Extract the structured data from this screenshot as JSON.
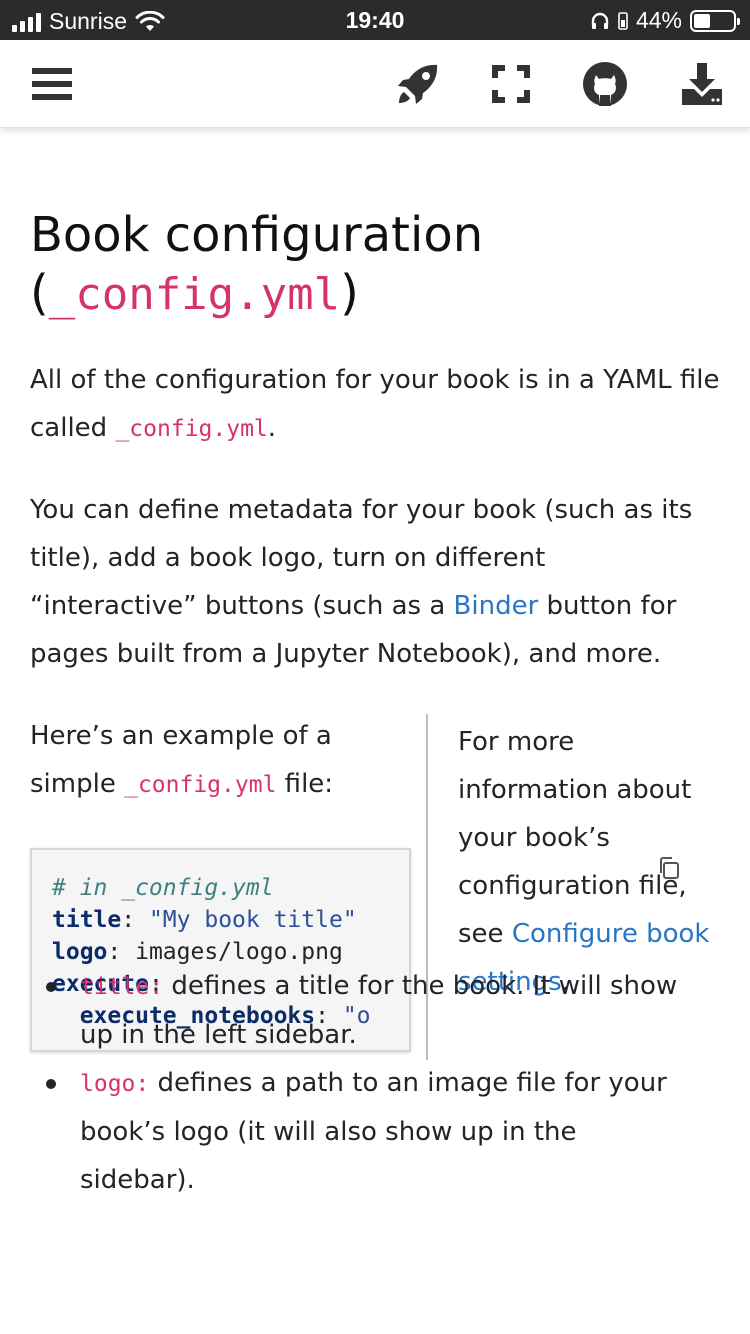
{
  "status_bar": {
    "carrier": "Sunrise",
    "time": "19:40",
    "battery": "44%",
    "battery_level": 0.44
  },
  "toolbar": {
    "icons": [
      "menu-icon",
      "rocket-icon",
      "fullscreen-icon",
      "github-icon",
      "download-icon"
    ]
  },
  "page": {
    "title": "Book configuration (",
    "title_code": "_config.yml",
    "title_end": ")",
    "intro": {
      "text": "All of the configuration for your book is in a YAML file called ",
      "code": "_config.yml",
      "end": "."
    },
    "para2": {
      "before": "You can define metadata for your book (such as its title), add a book logo, turn on different “interactive” buttons (such as a ",
      "link": "Binder",
      "after": " button for pages built from a Jupyter Notebook), and more."
    },
    "example": {
      "before": "Here’s an example of a simple ",
      "code": "_config.yml",
      "after": " file:"
    },
    "code_block": {
      "line1_comment": "# in _config.yml",
      "line2_key": "title",
      "line2_value": "\"My book title\"",
      "line3_key": "logo",
      "line3_value": "images/logo.png",
      "line4_key": "execute",
      "line5_key": "execute_notebooks",
      "line5_value": "\"o"
    },
    "side_note": {
      "text": "For more information about your book’s configuration file, see ",
      "link": "Configure book settings",
      "end": "."
    },
    "bullets": [
      {
        "code": "title:",
        "text": " defines a title for the book. It will show up in the left sidebar."
      },
      {
        "code": "logo:",
        "text": " defines a path to an image file for your book’s logo (it will also show up in the sidebar)."
      }
    ]
  }
}
